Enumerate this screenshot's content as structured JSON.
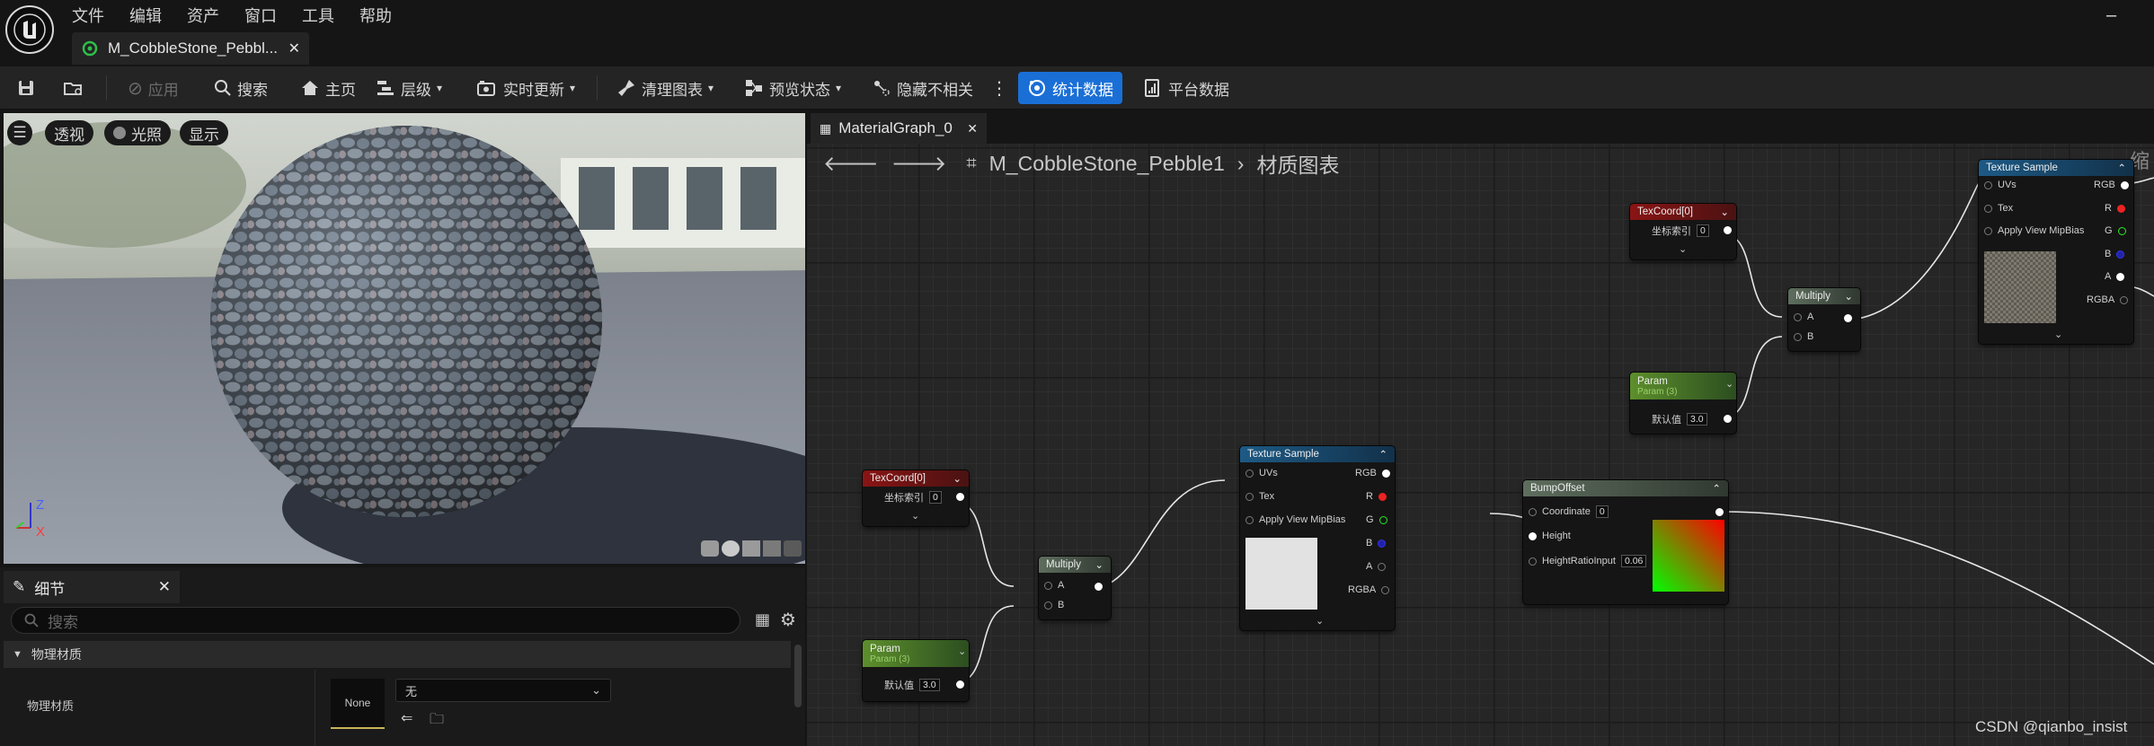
{
  "app": {
    "menu": [
      "文件",
      "编辑",
      "资产",
      "窗口",
      "工具",
      "帮助"
    ],
    "doc_tab": "M_CobbleStone_Pebbl...",
    "minimize": "–"
  },
  "toolbar": {
    "apply": "应用",
    "search": "搜索",
    "home": "主页",
    "hierarchy": "层级",
    "live_update": "实时更新",
    "clean_graph": "清理图表",
    "preview_state": "预览状态",
    "hide_unrelated": "隐藏不相关",
    "stats": "统计数据",
    "platform_stats": "平台数据"
  },
  "viewport": {
    "perspective": "透视",
    "lit": "光照",
    "show": "显示",
    "axis_z": "Z",
    "axis_x": "X"
  },
  "details": {
    "tab": "细节",
    "search_placeholder": "搜索",
    "section": "物理材质",
    "prop_label": "物理材质",
    "thumb": "None",
    "dropdown": "无"
  },
  "graph": {
    "tab": "MaterialGraph_0",
    "crumb_asset": "M_CobbleStone_Pebble1",
    "crumb_graph": "材质图表",
    "corner_text": "缩",
    "watermark": "CSDN @qianbo_insist"
  },
  "nodes": {
    "texcoord": {
      "title": "TexCoord[0]",
      "coord_label": "坐标索引",
      "coord_value": "0"
    },
    "param": {
      "title": "Param",
      "subtitle": "Param (3)",
      "default_label": "默认值",
      "default_value": "3.0"
    },
    "multiply": {
      "title": "Multiply",
      "a": "A",
      "b": "B"
    },
    "texsample": {
      "title": "Texture Sample",
      "uvs": "UVs",
      "tex": "Tex",
      "mip": "Apply View MipBias",
      "rgb": "RGB",
      "r": "R",
      "g": "G",
      "b": "B",
      "a": "A",
      "rgba": "RGBA"
    },
    "bump": {
      "title": "BumpOffset",
      "coordinate": "Coordinate",
      "coordinate_value": "0",
      "height": "Height",
      "ratio": "HeightRatioInput",
      "ratio_value": "0.06"
    }
  },
  "colors": {
    "accent": "#1a6fd6",
    "texcoord": "#8a1414",
    "param": "#5d8f2c",
    "texture": "#1d5a85",
    "bump": "#5e6e5e",
    "doc_icon": "#2fbf4a"
  }
}
